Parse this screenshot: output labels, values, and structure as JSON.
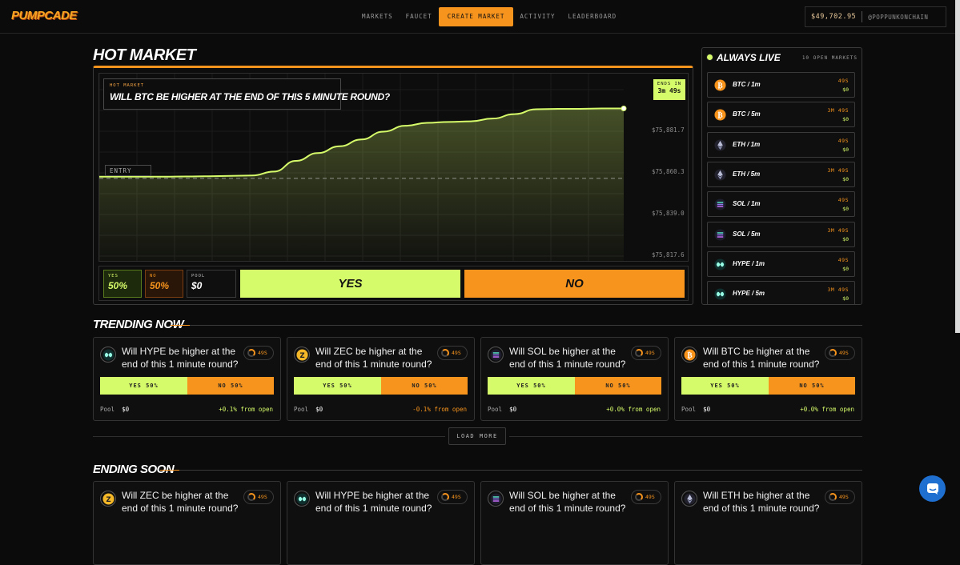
{
  "header": {
    "logo": "PUMPCADE",
    "nav": [
      "MARKETS",
      "FAUCET",
      "CREATE MARKET",
      "ACTIVITY",
      "LEADERBOARD"
    ],
    "active_nav": "CREATE MARKET",
    "balance": "$49,702.95",
    "user": "@POPPUNKONCHAIN"
  },
  "hot_market": {
    "section_title": "HOT MARKET",
    "kicker": "HOT MARKET",
    "question": "WILL BTC BE HIGHER AT THE END OF THIS 5 MINUTE ROUND?",
    "ends_label": "ENDS IN",
    "ends_value": "3m 49s",
    "entry_label": "ENTRY",
    "yticks": [
      "$75,881.7",
      "$75,860.3",
      "$75,839.0",
      "$75,817.6"
    ],
    "yes_label": "YES",
    "yes_value": "50%",
    "no_label": "NO",
    "no_value": "50%",
    "pool_label": "POOL",
    "pool_value": "$0",
    "yes_button": "YES",
    "no_button": "NO"
  },
  "chart_data": {
    "type": "line",
    "title": "",
    "ylabel": "",
    "y_ticks": [
      75881.7,
      75860.3,
      75839.0,
      75817.6
    ],
    "entry_price": 75857.5,
    "values": [
      75858.4,
      75858.4,
      75858.4,
      75858.4,
      75858.5,
      75858.6,
      75858.8,
      75859.0,
      75861.0,
      75866.5,
      75870.5,
      75874.0,
      75877.5,
      75881.5,
      75884.5,
      75886.0,
      75886.5,
      75886.8,
      75888.2,
      75890.5,
      75893.0,
      75893.2,
      75893.2,
      75893.4,
      75893.4
    ]
  },
  "always_live": {
    "title": "ALWAYS LIVE",
    "count": "10 OPEN MARKETS",
    "items": [
      {
        "name": "BTC / 1m",
        "time": "49S",
        "pool": "$0",
        "icon": "btc-icon",
        "color": "#f7931a"
      },
      {
        "name": "BTC / 5m",
        "time": "3M 49S",
        "pool": "$0",
        "icon": "btc-icon",
        "color": "#f7931a"
      },
      {
        "name": "ETH / 1m",
        "time": "49S",
        "pool": "$0",
        "icon": "eth-icon",
        "color": "#3c3c5a"
      },
      {
        "name": "ETH / 5m",
        "time": "3M 49S",
        "pool": "$0",
        "icon": "eth-icon",
        "color": "#3c3c5a"
      },
      {
        "name": "SOL / 1m",
        "time": "49S",
        "pool": "$0",
        "icon": "sol-icon",
        "color": "#2a2a44"
      },
      {
        "name": "SOL / 5m",
        "time": "3M 49S",
        "pool": "$0",
        "icon": "sol-icon",
        "color": "#2a2a44"
      },
      {
        "name": "HYPE / 1m",
        "time": "49S",
        "pool": "$0",
        "icon": "hype-icon",
        "color": "#0f3b3a"
      },
      {
        "name": "HYPE / 5m",
        "time": "3M 49S",
        "pool": "$0",
        "icon": "hype-icon",
        "color": "#0f3b3a"
      }
    ]
  },
  "trending": {
    "title": "TRENDING NOW",
    "cards": [
      {
        "q": "Will HYPE be higher at the end of this 1 minute round?",
        "timer": "49S",
        "yes": "YES 50%",
        "no": "NO 50%",
        "pool_label": "Pool",
        "pool": "$0",
        "change": "+0.1% from open",
        "change_color": "#d6fb6a",
        "icon": "hype-icon"
      },
      {
        "q": "Will ZEC be higher at the end of this 1 minute round?",
        "timer": "49S",
        "yes": "YES 50%",
        "no": "NO 50%",
        "pool_label": "Pool",
        "pool": "$0",
        "change": "-0.1% from open",
        "change_color": "#f7941d",
        "icon": "zec-icon"
      },
      {
        "q": "Will SOL be higher at the end of this 1 minute round?",
        "timer": "49S",
        "yes": "YES 50%",
        "no": "NO 50%",
        "pool_label": "Pool",
        "pool": "$0",
        "change": "+0.0% from open",
        "change_color": "#d6fb6a",
        "icon": "sol-icon"
      },
      {
        "q": "Will BTC be higher at the end of this 1 minute round?",
        "timer": "49S",
        "yes": "YES 50%",
        "no": "NO 50%",
        "pool_label": "Pool",
        "pool": "$0",
        "change": "+0.0% from open",
        "change_color": "#d6fb6a",
        "icon": "btc-icon"
      }
    ],
    "load_more": "LOAD MORE"
  },
  "ending_soon": {
    "title": "ENDING SOON",
    "cards": [
      {
        "q": "Will ZEC be higher at the end of this 1 minute round?",
        "timer": "49S",
        "icon": "zec-icon"
      },
      {
        "q": "Will HYPE be higher at the end of this 1 minute round?",
        "timer": "49S",
        "icon": "hype-icon"
      },
      {
        "q": "Will SOL be higher at the end of this 1 minute round?",
        "timer": "49S",
        "icon": "sol-icon"
      },
      {
        "q": "Will ETH be higher at the end of this 1 minute round?",
        "timer": "49S",
        "icon": "eth-icon"
      }
    ]
  }
}
